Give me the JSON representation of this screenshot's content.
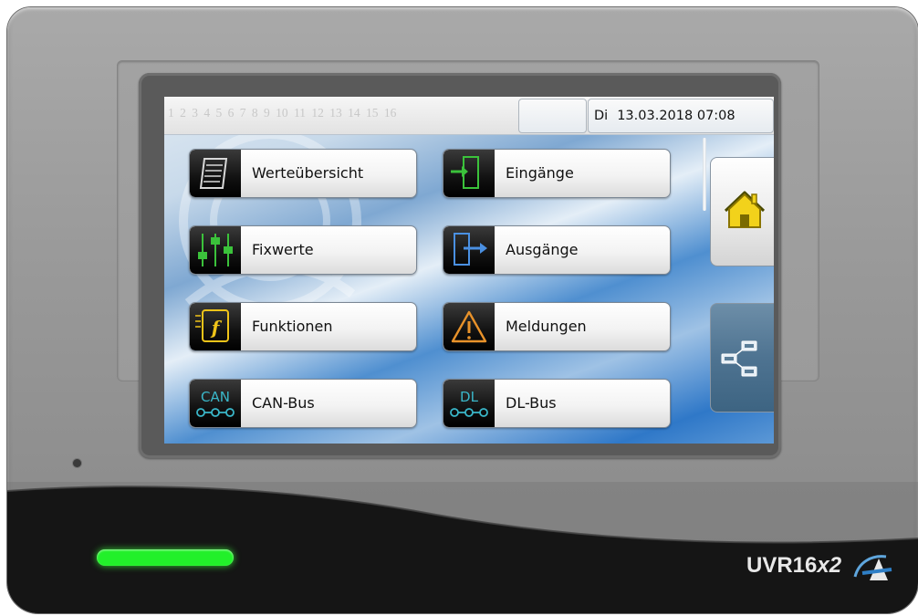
{
  "topbar": {
    "page_numbers": [
      "1",
      "2",
      "3",
      "4",
      "5",
      "6",
      "7",
      "8",
      "9",
      "10",
      "11",
      "12",
      "13",
      "14",
      "15",
      "16"
    ],
    "weekday": "Di",
    "date": "13.03.2018",
    "time": "07:08"
  },
  "menu": [
    {
      "label": "Werteübersicht",
      "icon": "document-list-icon",
      "color": "#cfcfcf"
    },
    {
      "label": "Eingänge",
      "icon": "input-arrow-icon",
      "color": "#3bc23b"
    },
    {
      "label": "Fixwerte",
      "icon": "sliders-icon",
      "color": "#3bc23b"
    },
    {
      "label": "Ausgänge",
      "icon": "output-arrow-icon",
      "color": "#4a90e2"
    },
    {
      "label": "Funktionen",
      "icon": "function-icon",
      "color": "#f0c419"
    },
    {
      "label": "Meldungen",
      "icon": "warning-icon",
      "color": "#e8922a"
    },
    {
      "label": "CAN-Bus",
      "icon": "can-bus-icon",
      "icon_text": "CAN",
      "color": "#3ab7c9"
    },
    {
      "label": "DL-Bus",
      "icon": "dl-bus-icon",
      "icon_text": "DL",
      "color": "#3ab7c9"
    }
  ],
  "side": {
    "home_icon": "home-icon",
    "network_icon": "network-icon"
  },
  "device": {
    "brand_main": "UVR16",
    "brand_suffix": "x2",
    "led_color": "#22f02a"
  }
}
